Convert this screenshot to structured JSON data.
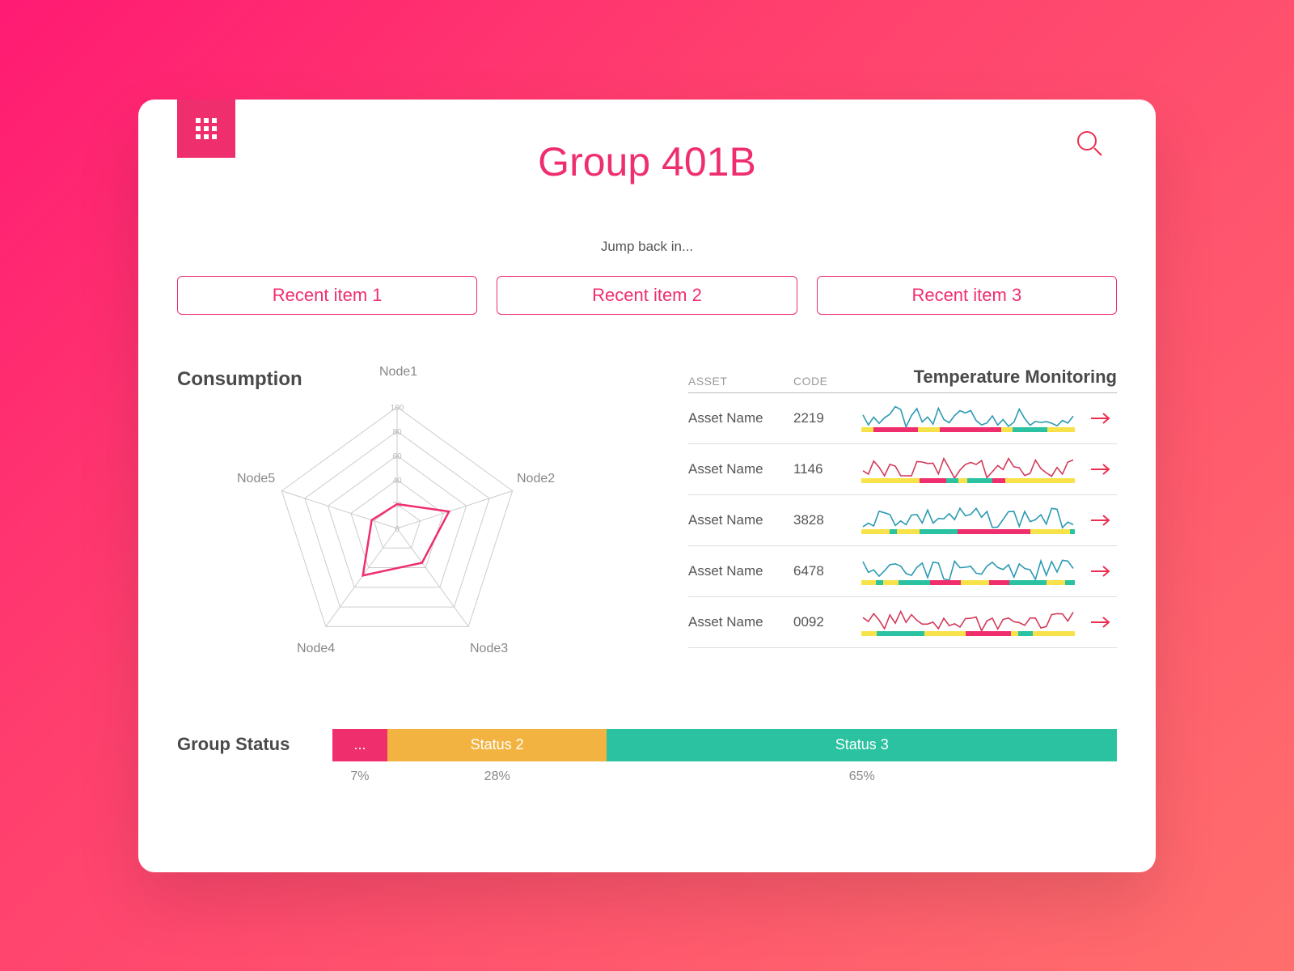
{
  "header": {
    "title": "Group 401B",
    "subtitle": "Jump back in..."
  },
  "recent_items": [
    "Recent item 1",
    "Recent item 2",
    "Recent item 3"
  ],
  "consumption": {
    "heading": "Consumption"
  },
  "temperature": {
    "header_asset": "ASSET",
    "header_code": "CODE",
    "title": "Temperature Monitoring",
    "rows": [
      {
        "name": "Asset Name",
        "code": "2219",
        "color": "#2b9ab3"
      },
      {
        "name": "Asset Name",
        "code": "1146",
        "color": "#d33a5a"
      },
      {
        "name": "Asset Name",
        "code": "3828",
        "color": "#2b9ab3"
      },
      {
        "name": "Asset Name",
        "code": "6478",
        "color": "#2b9ab3"
      },
      {
        "name": "Asset Name",
        "code": "0092",
        "color": "#d33a5a"
      }
    ]
  },
  "group_status": {
    "label": "Group Status",
    "segments": [
      {
        "label": "...",
        "pct": "7%",
        "width": 7,
        "color": "#ef2e6e"
      },
      {
        "label": "Status 2",
        "pct": "28%",
        "width": 28,
        "color": "#f3b340"
      },
      {
        "label": "Status 3",
        "pct": "65%",
        "width": 65,
        "color": "#2ac2a0"
      }
    ]
  },
  "chart_data": {
    "type": "radar",
    "title": "Consumption",
    "categories": [
      "Node1",
      "Node2",
      "Node3",
      "Node4",
      "Node5"
    ],
    "ticks": [
      0,
      20,
      40,
      60,
      80,
      100
    ],
    "series": [
      {
        "name": "Group 401B",
        "values": [
          20,
          45,
          35,
          48,
          22
        ],
        "color": "#ef2e6e"
      }
    ]
  },
  "colors": {
    "accent": "#ef2e6e",
    "teal": "#2ac2a0",
    "yellow": "#f3b340",
    "blue": "#2b9ab3"
  }
}
